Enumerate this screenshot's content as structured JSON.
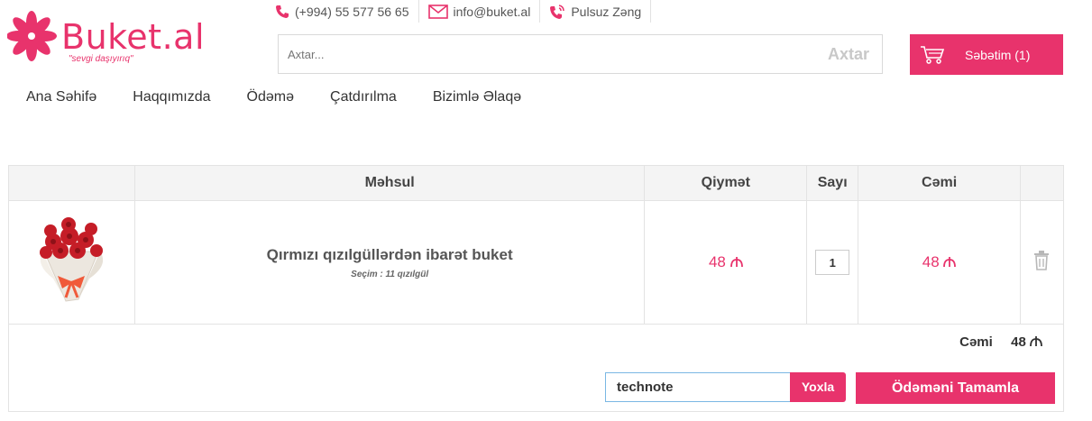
{
  "brand": {
    "name": "Buket.al",
    "tagline": "\"sevgi daşıyırıq\"",
    "color": "#e8336c"
  },
  "contacts": [
    {
      "icon": "phone-icon",
      "text": "(+994) 55 577 56 65"
    },
    {
      "icon": "envelope-icon",
      "text": "info@buket.al"
    },
    {
      "icon": "phone-call-icon",
      "text": "Pulsuz Zəng"
    }
  ],
  "search": {
    "placeholder": "Axtar...",
    "button_label": "Axtar"
  },
  "cart": {
    "icon": "cart-icon",
    "label": "Səbətim (1)"
  },
  "nav": [
    "Ana Səhifə",
    "Haqqımızda",
    "Ödəmə",
    "Çatdırılma",
    "Bizimlə Əlaqə"
  ],
  "table": {
    "headers": [
      "",
      "Məhsul",
      "Qiymət",
      "Sayı",
      "Cəmi",
      ""
    ],
    "rows": [
      {
        "image": "red-roses-bouquet",
        "name": "Qırmızı qızılgüllərdən ibarət buket",
        "selection": "Seçim : 11 qızılgül",
        "price": "48",
        "quantity": "1",
        "total": "48",
        "currency_icon": "manat-icon",
        "delete_icon": "trash-icon"
      }
    ]
  },
  "summary": {
    "total_label": "Cəmi",
    "total_value": "48"
  },
  "coupon": {
    "value": "technote",
    "button_label": "Yoxla"
  },
  "checkout_label": "Ödəməni Tamamla"
}
